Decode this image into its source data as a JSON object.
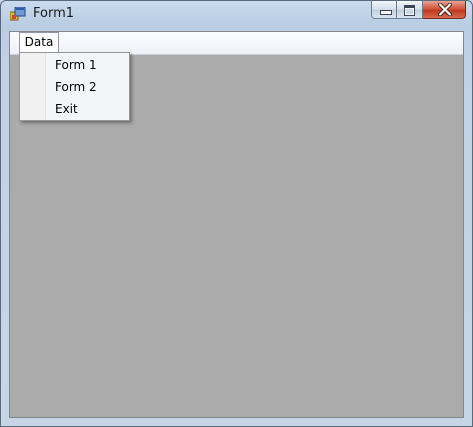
{
  "window": {
    "title": "Form1",
    "icon": "windows-form-icon",
    "controls": [
      "minimize-icon",
      "maximize-icon",
      "close-icon"
    ]
  },
  "menubar": {
    "items": [
      {
        "label": "Data",
        "open": true,
        "submenu": [
          {
            "label": "Form 1"
          },
          {
            "label": "Form 2"
          },
          {
            "label": "Exit"
          }
        ]
      }
    ]
  },
  "colors": {
    "client_background": "#ababab",
    "close_button": "#c1391f"
  }
}
